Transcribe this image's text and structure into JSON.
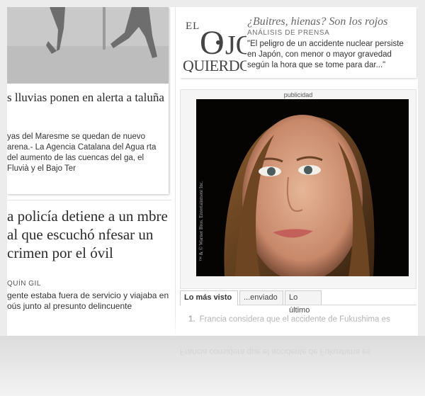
{
  "story1": {
    "headline": "s lluvias ponen en alerta a taluña",
    "summary": "yas del Maresme se quedan de nuevo arena.- La Agencia Catalana del Agua rta del aumento de las cuencas del ga, el Fluvià y el Bajo Ter"
  },
  "story2": {
    "headline": "a policía detiene a un mbre al que escuchó nfesar un crimen por el óvil",
    "author": "QUÍN GIL",
    "summary": "gente estaba fuera de servicio y viajaba en oús junto al presunto delincuente"
  },
  "promo": {
    "logo_text": "EL OJO QUIERDO",
    "title": "¿Buitres, hienas? Son los rojos",
    "kicker": "ANÁLISIS DE PRENSA",
    "quote": "\"El peligro de un accidente nuclear persiste en Japón, con menor o mayor gravedad según la hora que se tome para dar...\""
  },
  "ad": {
    "label": "publicidad",
    "credit": "™ & © Warner Bros. Entertainment Inc."
  },
  "tabs": [
    "Lo más visto",
    "...enviado",
    "Lo último"
  ],
  "most_viewed": [
    {
      "num": "1.",
      "text": "Francia considera que el accidente de Fukushima es"
    }
  ]
}
